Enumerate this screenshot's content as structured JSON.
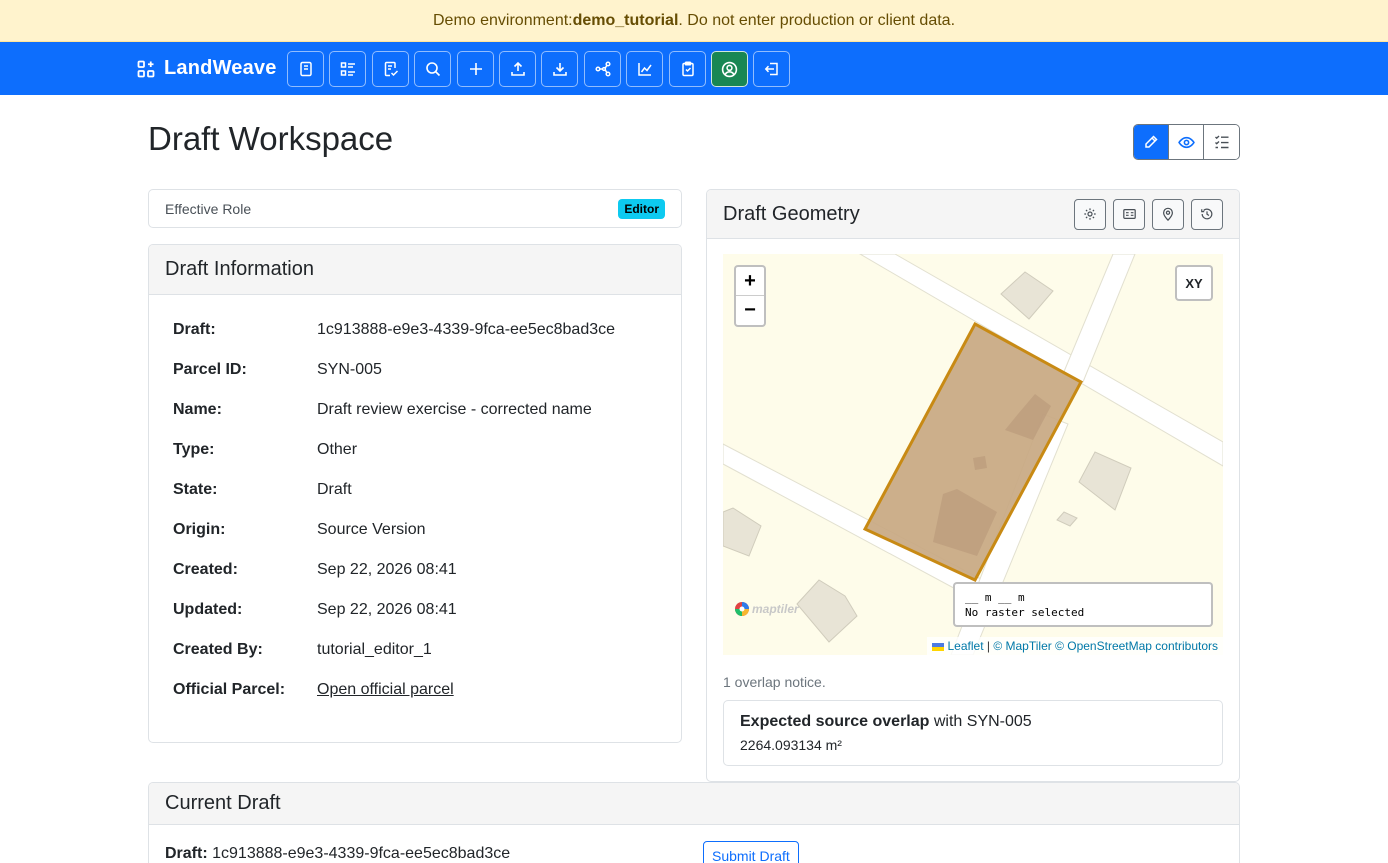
{
  "banner": {
    "prefix": "Demo environment: ",
    "env_name": "demo_tutorial",
    "suffix": ". Do not enter production or client data."
  },
  "navbar": {
    "brand": "LandWeave",
    "buttons": [
      {
        "icon": "journal-icon"
      },
      {
        "icon": "list-details-icon"
      },
      {
        "icon": "review-check-icon"
      },
      {
        "icon": "search-icon"
      },
      {
        "icon": "plus-icon"
      },
      {
        "icon": "upload-icon"
      },
      {
        "icon": "download-icon"
      },
      {
        "icon": "diagram-icon"
      },
      {
        "icon": "chart-icon"
      },
      {
        "icon": "clipboard-icon"
      },
      {
        "icon": "account-icon",
        "active": true
      },
      {
        "icon": "logout-icon"
      }
    ],
    "color": "#0d6efd",
    "active_color": "#198754"
  },
  "page": {
    "title": "Draft Workspace"
  },
  "view_toggle": [
    {
      "icon": "pencil-icon",
      "active": true
    },
    {
      "icon": "eye-icon"
    },
    {
      "icon": "checklist-icon"
    }
  ],
  "role": {
    "label": "Effective Role",
    "value": "Editor"
  },
  "draft_info": {
    "title": "Draft Information",
    "rows": [
      {
        "key": "Draft:",
        "value": "1c913888-e9e3-4339-9fca-ee5ec8bad3ce"
      },
      {
        "key": "Parcel ID:",
        "value": "SYN-005"
      },
      {
        "key": "Name:",
        "value": "Draft review exercise - corrected name"
      },
      {
        "key": "Type:",
        "value": "Other"
      },
      {
        "key": "State:",
        "value": "Draft"
      },
      {
        "key": "Origin:",
        "value": "Source Version"
      },
      {
        "key": "Created:",
        "value": "Sep 22, 2026 08:41"
      },
      {
        "key": "Updated:",
        "value": "Sep 22, 2026 08:41"
      },
      {
        "key": "Created By:",
        "value": "tutorial_editor_1"
      }
    ],
    "official_parcel": {
      "key": "Official Parcel:",
      "link": "Open official parcel"
    }
  },
  "geometry": {
    "title": "Draft Geometry",
    "tools": [
      {
        "icon": "settings-icon"
      },
      {
        "icon": "id-card-icon"
      },
      {
        "icon": "location-pin-icon"
      },
      {
        "icon": "history-icon"
      }
    ],
    "map": {
      "zoom_in": "+",
      "zoom_out": "−",
      "xy_button": "XY",
      "measure_line": "__ m __ m",
      "raster_status": "No raster selected",
      "logo_text": "maptiler",
      "attribution_leaflet": "Leaflet",
      "attribution_sep": " | ",
      "attribution_maptiler": "© MapTiler",
      "attribution_osm": "© OpenStreetMap contributors",
      "parcel_fill": "#c8a882",
      "parcel_stroke": "#c88a14"
    },
    "overlap_notice": "1 overlap notice.",
    "overlap": {
      "title": "Expected source overlap",
      "with_text": " with SYN-005",
      "area": "2264.093134 m²"
    }
  },
  "current_draft": {
    "title": "Current Draft",
    "draft_label": "Draft:",
    "draft_value": " 1c913888-e9e3-4339-9fca-ee5ec8bad3ce",
    "submit_label": "Submit Draft"
  }
}
